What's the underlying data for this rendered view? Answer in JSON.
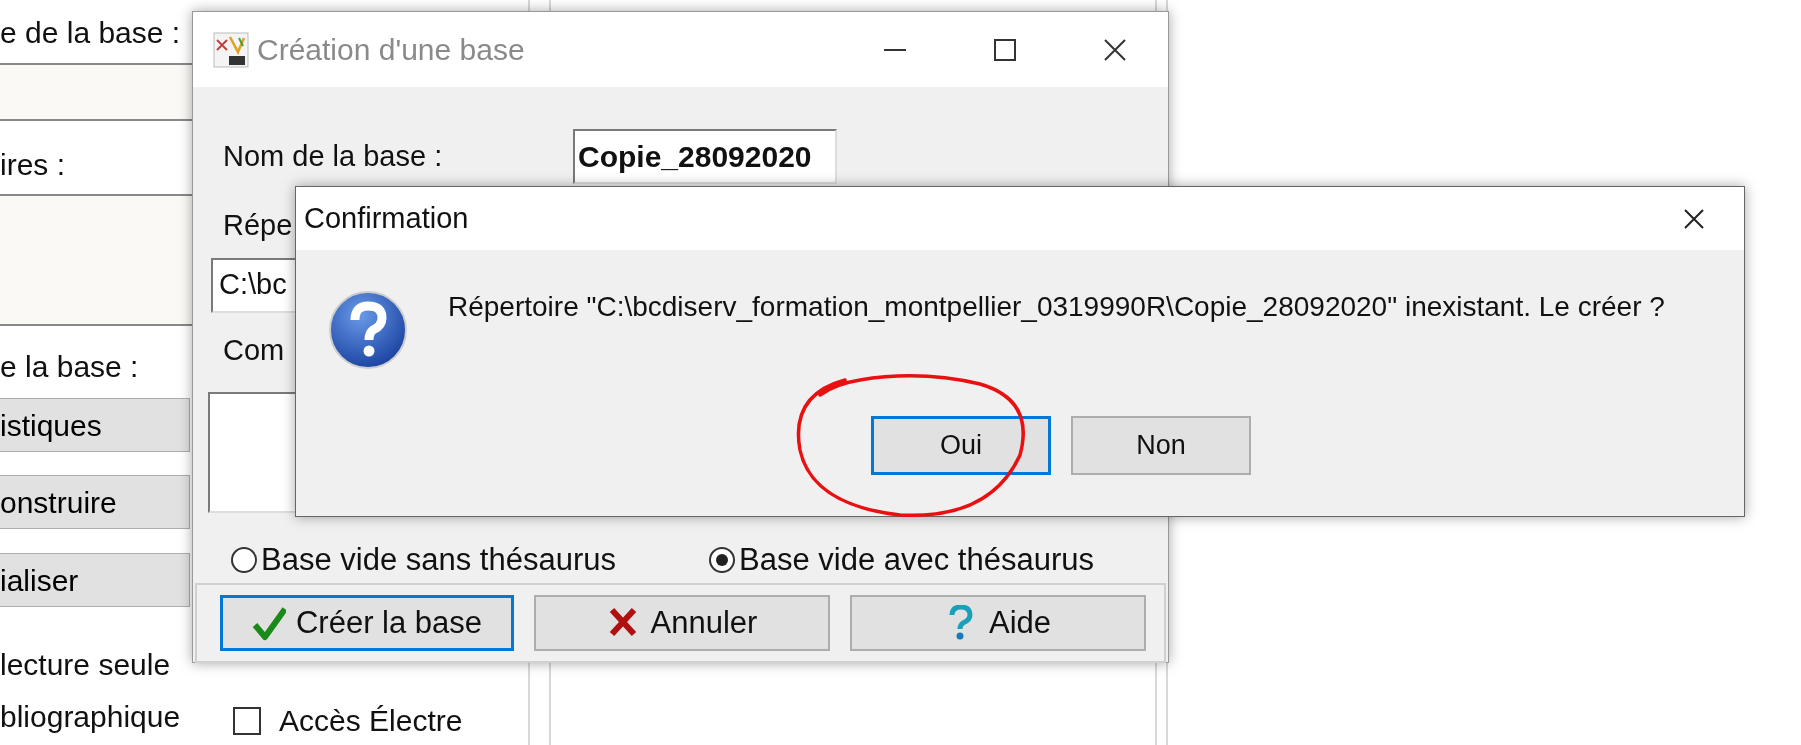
{
  "background_window": {
    "labels": [
      "e de la base :",
      "ires :",
      "e la base :"
    ],
    "buttons": [
      "istiques",
      "onstruire",
      "ialiser"
    ],
    "options": [
      "lecture seule",
      "bliographique"
    ],
    "checkboxes": [
      {
        "label": "Accès Électre",
        "checked": false
      }
    ]
  },
  "create_dialog": {
    "title": "Création d'une base",
    "active": false,
    "name_label": "Nom de la base :",
    "name_value": "Copie_28092020",
    "directory_label": "Répe",
    "directory_value": "C:\\bc",
    "comment_label": "Com",
    "radios": [
      {
        "label": "Base vide sans thésaurus",
        "selected": false
      },
      {
        "label": "Base vide avec thésaurus",
        "selected": true
      }
    ],
    "buttons": [
      {
        "label": "Créer la base",
        "kind": "confirm",
        "focused": true
      },
      {
        "label": "Annuler",
        "kind": "cancel",
        "focused": false
      },
      {
        "label": "Aide",
        "kind": "help",
        "focused": false
      }
    ]
  },
  "confirm_dialog": {
    "title": "Confirmation",
    "message": "Répertoire \"C:\\bcdiserv_formation_montpellier_0319990R\\Copie_28092020\" inexistant. Le créer ?",
    "buttons": [
      {
        "label": "Oui",
        "focused": true
      },
      {
        "label": "Non",
        "focused": false
      }
    ]
  }
}
